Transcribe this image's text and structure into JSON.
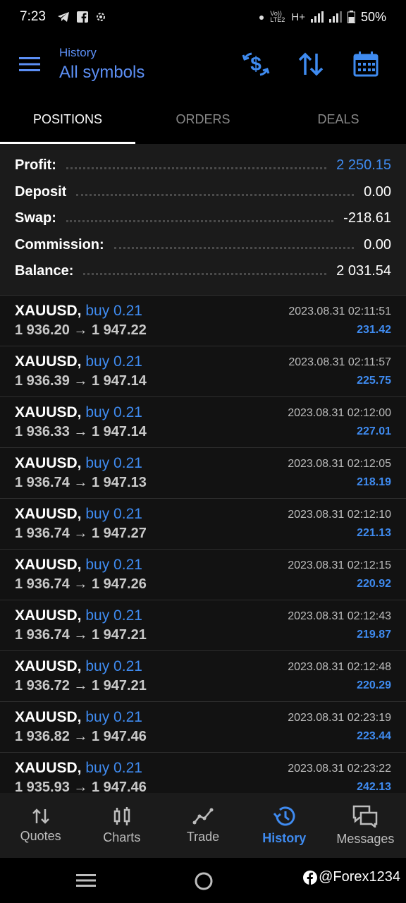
{
  "statusbar": {
    "time": "7:23",
    "network": "H+",
    "battery": "50%",
    "volte": "Vo)) LTE2"
  },
  "header": {
    "subtitle": "History",
    "title": "All symbols",
    "icons": [
      "menu-icon",
      "currency-exchange-icon",
      "sort-icon",
      "calendar-icon"
    ]
  },
  "tabs": [
    "POSITIONS",
    "ORDERS",
    "DEALS"
  ],
  "summary": {
    "profit_label": "Profit:",
    "profit": "2 250.15",
    "deposit_label": "Deposit",
    "deposit": "0.00",
    "swap_label": "Swap:",
    "swap": "-218.61",
    "commission_label": "Commission:",
    "commission": "0.00",
    "balance_label": "Balance:",
    "balance": "2 031.54"
  },
  "positions": [
    {
      "symbol": "XAUUSD,",
      "type": "buy 0.21",
      "open": "1 936.20",
      "close": "1 947.22",
      "time": "2023.08.31 02:11:51",
      "profit": "231.42"
    },
    {
      "symbol": "XAUUSD,",
      "type": "buy 0.21",
      "open": "1 936.39",
      "close": "1 947.14",
      "time": "2023.08.31 02:11:57",
      "profit": "225.75"
    },
    {
      "symbol": "XAUUSD,",
      "type": "buy 0.21",
      "open": "1 936.33",
      "close": "1 947.14",
      "time": "2023.08.31 02:12:00",
      "profit": "227.01"
    },
    {
      "symbol": "XAUUSD,",
      "type": "buy 0.21",
      "open": "1 936.74",
      "close": "1 947.13",
      "time": "2023.08.31 02:12:05",
      "profit": "218.19"
    },
    {
      "symbol": "XAUUSD,",
      "type": "buy 0.21",
      "open": "1 936.74",
      "close": "1 947.27",
      "time": "2023.08.31 02:12:10",
      "profit": "221.13"
    },
    {
      "symbol": "XAUUSD,",
      "type": "buy 0.21",
      "open": "1 936.74",
      "close": "1 947.26",
      "time": "2023.08.31 02:12:15",
      "profit": "220.92"
    },
    {
      "symbol": "XAUUSD,",
      "type": "buy 0.21",
      "open": "1 936.74",
      "close": "1 947.21",
      "time": "2023.08.31 02:12:43",
      "profit": "219.87"
    },
    {
      "symbol": "XAUUSD,",
      "type": "buy 0.21",
      "open": "1 936.72",
      "close": "1 947.21",
      "time": "2023.08.31 02:12:48",
      "profit": "220.29"
    },
    {
      "symbol": "XAUUSD,",
      "type": "buy 0.21",
      "open": "1 936.82",
      "close": "1 947.46",
      "time": "2023.08.31 02:23:19",
      "profit": "223.44"
    },
    {
      "symbol": "XAUUSD,",
      "type": "buy 0.21",
      "open": "1 935.93",
      "close": "1 947.46",
      "time": "2023.08.31 02:23:22",
      "profit": "242.13"
    }
  ],
  "bottom_nav": [
    {
      "label": "Quotes",
      "icon": "quotes-icon"
    },
    {
      "label": "Charts",
      "icon": "charts-icon"
    },
    {
      "label": "Trade",
      "icon": "trade-icon"
    },
    {
      "label": "History",
      "icon": "history-icon",
      "active": true
    },
    {
      "label": "Messages",
      "icon": "messages-icon"
    }
  ],
  "watermark": "@Forex1234",
  "colors": {
    "accent": "#3f8bf0",
    "background": "#000000",
    "panel": "#1b1b1b"
  }
}
